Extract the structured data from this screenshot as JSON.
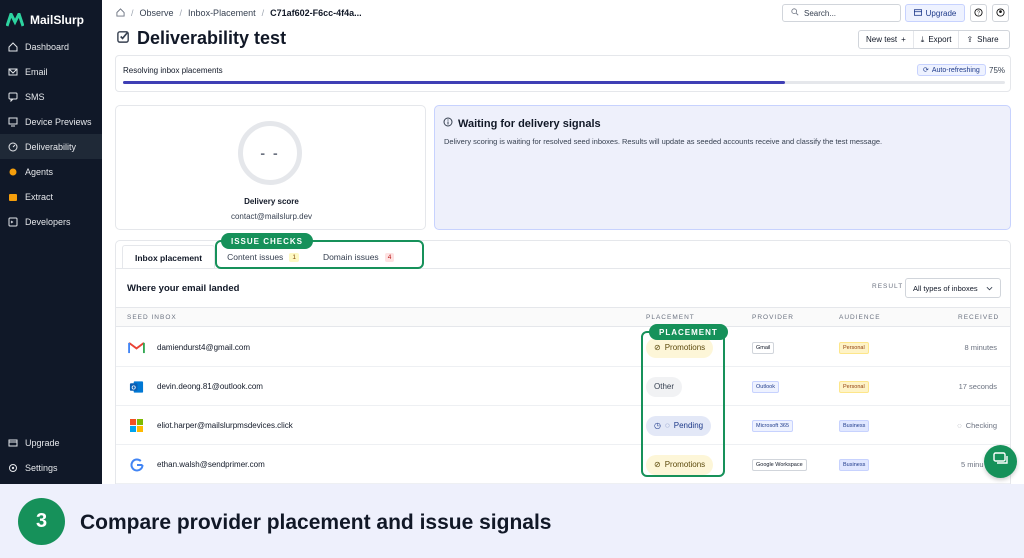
{
  "app": {
    "name": "MailSlurp"
  },
  "sidebar": {
    "items": [
      {
        "label": "Dashboard",
        "icon": "home-icon"
      },
      {
        "label": "Email",
        "icon": "mail-icon"
      },
      {
        "label": "SMS",
        "icon": "message-icon"
      },
      {
        "label": "Device Previews",
        "icon": "device-icon"
      },
      {
        "label": "Deliverability",
        "icon": "gauge-icon",
        "active": true
      },
      {
        "label": "Agents",
        "icon": "agent-icon"
      },
      {
        "label": "Extract",
        "icon": "extract-icon"
      },
      {
        "label": "Developers",
        "icon": "terminal-icon"
      }
    ],
    "bottom": [
      {
        "label": "Upgrade",
        "icon": "upgrade-icon"
      },
      {
        "label": "Settings",
        "icon": "gear-icon"
      }
    ]
  },
  "breadcrumb": {
    "items": [
      "Observe",
      "Inbox-Placement"
    ],
    "current": "C71af602-F6cc-4f4a..."
  },
  "topbar": {
    "search_placeholder": "Search...",
    "upgrade_label": "Upgrade"
  },
  "page": {
    "title": "Deliverability test"
  },
  "actions": {
    "new_test": "New test",
    "export": "Export",
    "share": "Share"
  },
  "progress": {
    "label": "Resolving inbox placements",
    "badge": "Auto-refreshing",
    "percent_text": "75%",
    "value": 0.75
  },
  "score": {
    "value": "- -",
    "label": "Delivery score",
    "email": "contact@mailslurp.dev"
  },
  "waiting": {
    "title": "Waiting for delivery signals",
    "description": "Delivery scoring is waiting for resolved seed inboxes. Results will update as seeded accounts receive and classify the test message."
  },
  "tabs": [
    {
      "label": "Inbox placement",
      "active": true
    },
    {
      "label": "Content issues",
      "count": "1",
      "badge": "yellow"
    },
    {
      "label": "Domain issues",
      "count": "4",
      "badge": "red"
    }
  ],
  "table": {
    "heading": "Where your email landed",
    "result_label": "RESULT",
    "result_value": "All types of inboxes",
    "columns": {
      "seed": "SEED INBOX",
      "placement": "PLACEMENT",
      "provider": "PROVIDER",
      "audience": "AUDIENCE",
      "received": "RECEIVED"
    },
    "rows": [
      {
        "logo": "gmail-icon",
        "email": "damiendurst4@gmail.com",
        "placement": "Promotions",
        "placement_style": "yellow",
        "provider": "Gmail",
        "audience": "Personal",
        "received": "8 minutes"
      },
      {
        "logo": "outlook-icon",
        "email": "devin.deong.81@outlook.com",
        "placement": "Other",
        "placement_style": "gray",
        "provider": "Outlook",
        "audience": "Personal",
        "received": "17 seconds"
      },
      {
        "logo": "microsoft-icon",
        "email": "eliot.harper@mailslurpmsdevices.click",
        "placement": "Pending",
        "placement_style": "blue",
        "provider": "Microsoft 365",
        "audience": "Business",
        "received": "Checking"
      },
      {
        "logo": "google-icon",
        "email": "ethan.walsh@sendprimer.com",
        "placement": "Promotions",
        "placement_style": "yellow",
        "provider": "Google Workspace",
        "audience": "Business",
        "received": "5 minu"
      }
    ]
  },
  "callouts": {
    "issue_checks": "ISSUE CHECKS",
    "placement": "PLACEMENT"
  },
  "banner": {
    "step": "3",
    "text": "Compare provider placement and issue signals"
  },
  "colors": {
    "accent_green": "#16915a",
    "sidebar_bg": "#101828",
    "progress": "#3f3fb5"
  }
}
